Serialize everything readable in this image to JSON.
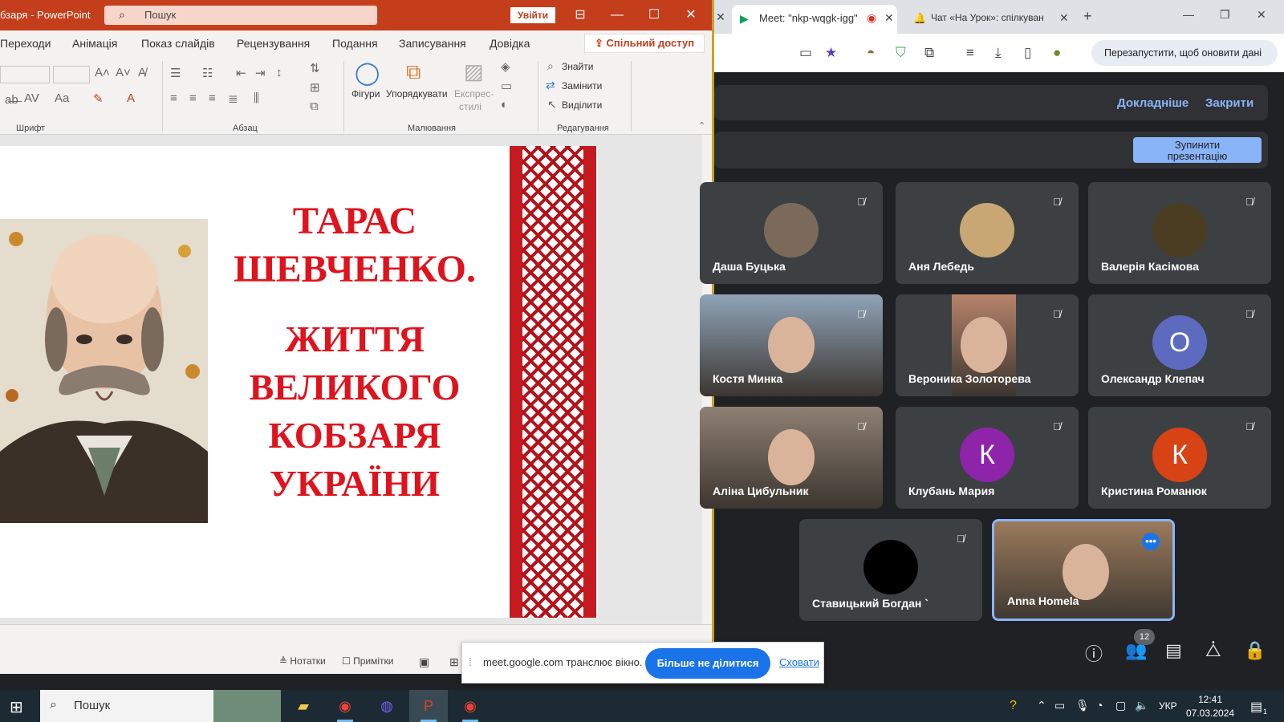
{
  "ppt": {
    "title": "бзаря - PowerPoint",
    "search_placeholder": "Пошук",
    "sign_in": "Увійти",
    "tabs": [
      "Переходи",
      "Анімація",
      "Показ слайдів",
      "Рецензування",
      "Подання",
      "Записування",
      "Довідка"
    ],
    "share": "Спільний доступ",
    "ribbon": {
      "groups": [
        "Шрифт",
        "Абзац",
        "Малювання",
        "Редагування"
      ],
      "shapes": "Фігури",
      "arrange": "Упорядкувати",
      "quick_styles_line1": "Експрес-",
      "quick_styles_line2": "стилі",
      "find": "Знайти",
      "replace": "Замінити",
      "select": "Виділити"
    },
    "slide": {
      "lines": [
        "ТАРАС",
        "ШЕВЧЕНКО.",
        "ЖИТТЯ",
        "ВЕЛИКОГО",
        "КОБЗАРЯ",
        "УКРАЇНИ"
      ]
    },
    "status": {
      "notes": "Нотатки",
      "comments": "Примітки"
    }
  },
  "chrome": {
    "tabs": [
      {
        "label": "Meet: \"nkp-wqgk-igg\"",
        "active": true
      },
      {
        "label": "Чат «На Урок»: спілкуван",
        "active": false
      }
    ],
    "update_button": "Перезапустити, щоб оновити дані"
  },
  "meet": {
    "banner": {
      "learn_more": "Докладніше",
      "close": "Закрити"
    },
    "stop_presenting_line1": "Зупинити",
    "stop_presenting_line2": "презентацію",
    "participants": [
      {
        "name": "Даша Буцька",
        "kind": "photo",
        "color": "#7b6a5a"
      },
      {
        "name": "Аня Лебедь",
        "kind": "photo",
        "color": "#c9a774"
      },
      {
        "name": "Валерія Касімова",
        "kind": "photo",
        "color": "#4a3d22"
      },
      {
        "name": "Костя Минка",
        "kind": "camera",
        "color": "#8fa4b8"
      },
      {
        "name": "Вероника Золоторева",
        "kind": "camera",
        "color": "#b7836a"
      },
      {
        "name": "Олександр Клепач",
        "kind": "letter",
        "letter": "О",
        "color": "#5c6bc0"
      },
      {
        "name": "Аліна Цибульник",
        "kind": "camera",
        "color": "#8e7f73"
      },
      {
        "name": "Клубань Мария",
        "kind": "letter",
        "letter": "К",
        "color": "#8e24aa"
      },
      {
        "name": "Кристина Романюк",
        "kind": "letter",
        "letter": "К",
        "color": "#d84315"
      },
      {
        "name": "Ставицький Богдан `",
        "kind": "photo",
        "color": "#000000"
      },
      {
        "name": "Anna Homela",
        "kind": "camera",
        "color": "#9a7a5c"
      }
    ],
    "people_count": "12",
    "share_notice": {
      "message": "meet.google.com транслює вікно.",
      "stop_sharing": "Більше не ділитися",
      "hide": "Сховати"
    }
  },
  "taskbar": {
    "search": "Пошук",
    "language": "УКР",
    "time": "12:41",
    "date": "07.03.2024",
    "notifications": "1"
  },
  "colors": {
    "ppt_accent": "#c43e1c",
    "meet_blue": "#8ab4f8",
    "slide_red": "#e0121c"
  }
}
